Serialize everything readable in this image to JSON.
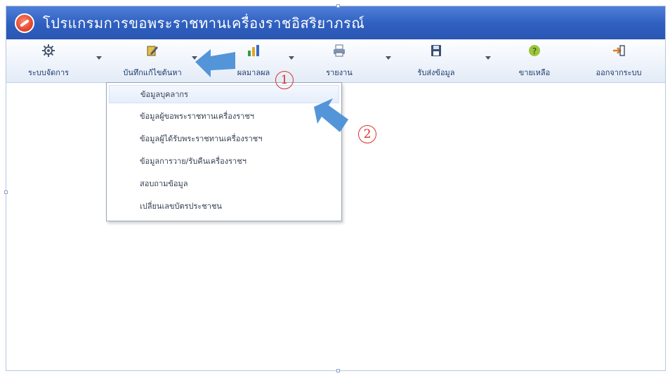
{
  "window": {
    "title": "โปรแกรมการขอพระราชทานเครื่องราชอิสริยาภรณ์"
  },
  "toolbar": {
    "buttons": [
      {
        "label": "ระบบจัดการ",
        "icon": "settings-icon"
      },
      {
        "label": "บันทึกแก้ไขต้นหา",
        "icon": "edit-book-icon"
      },
      {
        "label": "ผลมาลผล",
        "icon": "chart-icon"
      },
      {
        "label": "รายงาน",
        "icon": "printer-icon"
      },
      {
        "label": "รับส่งข้อมูล",
        "icon": "disk-icon"
      },
      {
        "label": "ขายเหลือ",
        "icon": "help-icon"
      },
      {
        "label": "ออกจากระบบ",
        "icon": "exit-icon"
      }
    ]
  },
  "menu": {
    "items": [
      {
        "label": "ข้อมูลบุคลากร"
      },
      {
        "label": "ข้อมูลผู้ขอพระราชทานเครื่องราชฯ"
      },
      {
        "label": "ข้อมูลผู้ได้รับพระราชทานเครื่องราชฯ"
      },
      {
        "label": "ข้อมูลการวาย/รับคืนเครื่องราชฯ"
      },
      {
        "label": "สอบถามข้อมูล"
      },
      {
        "label": "เปลี่ยนเลขบัตรประชาชน"
      }
    ]
  },
  "annotations": {
    "marker_1": "1",
    "marker_2": "2",
    "arrow_color": "#4a8fd6",
    "marker_color": "#d9332b"
  }
}
